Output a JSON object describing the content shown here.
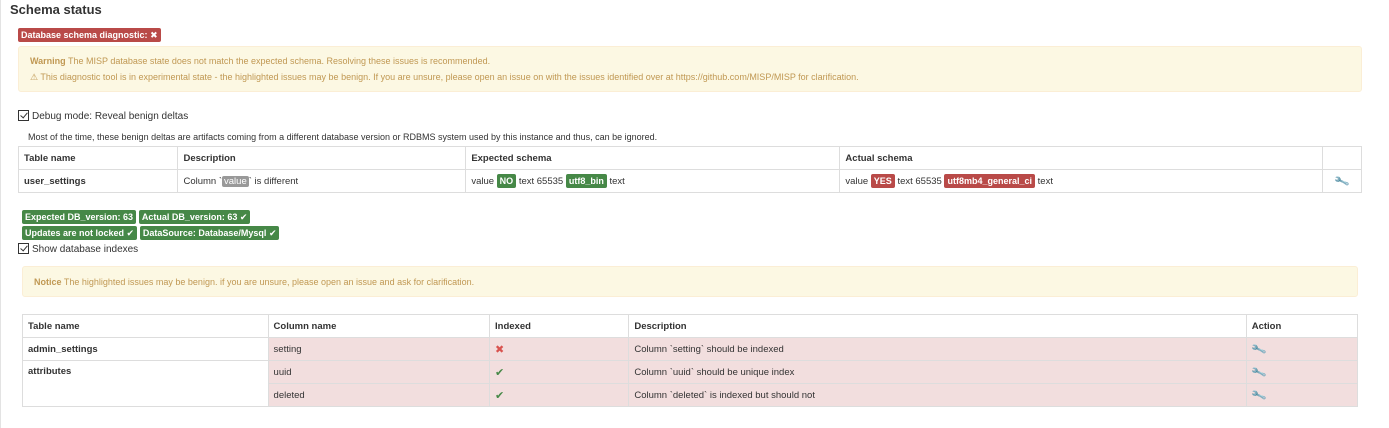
{
  "title": "Schema status",
  "diagnostic_badge": "Database schema diagnostic:",
  "warning": {
    "label": "Warning",
    "line1": " The MISP database state does not match the expected schema. Resolving these issues is recommended.",
    "line2": "⚠ This diagnostic tool is in experimental state - the highlighted issues may be benign. If you are unsure, please open an issue on with the issues identified over at https://github.com/MISP/MISP for clarification."
  },
  "debug_mode": {
    "label": "Debug mode: Reveal benign deltas",
    "hint": "Most of the time, these benign deltas are artifacts coming from a different database version or RDBMS system used by this instance and thus, can be ignored."
  },
  "schema_table": {
    "headers": [
      "Table name",
      "Description",
      "Expected schema",
      "Actual schema"
    ],
    "row": {
      "table": "user_settings",
      "desc_pre": "Column `",
      "desc_col": "value",
      "desc_post": "` is different",
      "exp_pre": "value",
      "exp_badge1": "NO",
      "exp_mid": "text 65535",
      "exp_badge2": "utf8_bin",
      "exp_post": "text",
      "act_pre": "value",
      "act_badge1": "YES",
      "act_mid": "text 65535",
      "act_badge2": "utf8mb4_general_ci",
      "act_post": "text"
    }
  },
  "status_badges": {
    "expected_version": "Expected DB_version: 63",
    "actual_version": "Actual DB_version: 63",
    "not_locked": "Updates are not locked",
    "datasource": "DataSource: Database/Mysql"
  },
  "show_indexes": {
    "label": "Show database indexes"
  },
  "notice": {
    "label": "Notice",
    "text": " The highlighted issues may be benign. if you are unsure, please open an issue and ask for clarification."
  },
  "index_table": {
    "headers": [
      "Table name",
      "Column name",
      "Indexed",
      "Description",
      "Action"
    ],
    "rows": [
      {
        "table": "admin_settings",
        "column": "setting",
        "indexed": "✖",
        "description": "Column `setting` should be indexed"
      },
      {
        "table": "attributes",
        "column": "uuid",
        "indexed": "✔",
        "description": "Column `uuid` should be unique index"
      },
      {
        "table": "",
        "column": "deleted",
        "indexed": "✔",
        "description": "Column `deleted` is indexed but should not"
      }
    ]
  },
  "icons": {
    "wrench": "wrench-icon",
    "check": "check-icon",
    "times": "times-icon"
  },
  "colors": {
    "danger": "#b94a48",
    "success": "#468847",
    "warning_bg": "#fcf8e3",
    "warning_text": "#c09853",
    "error_row": "#f2dede"
  }
}
